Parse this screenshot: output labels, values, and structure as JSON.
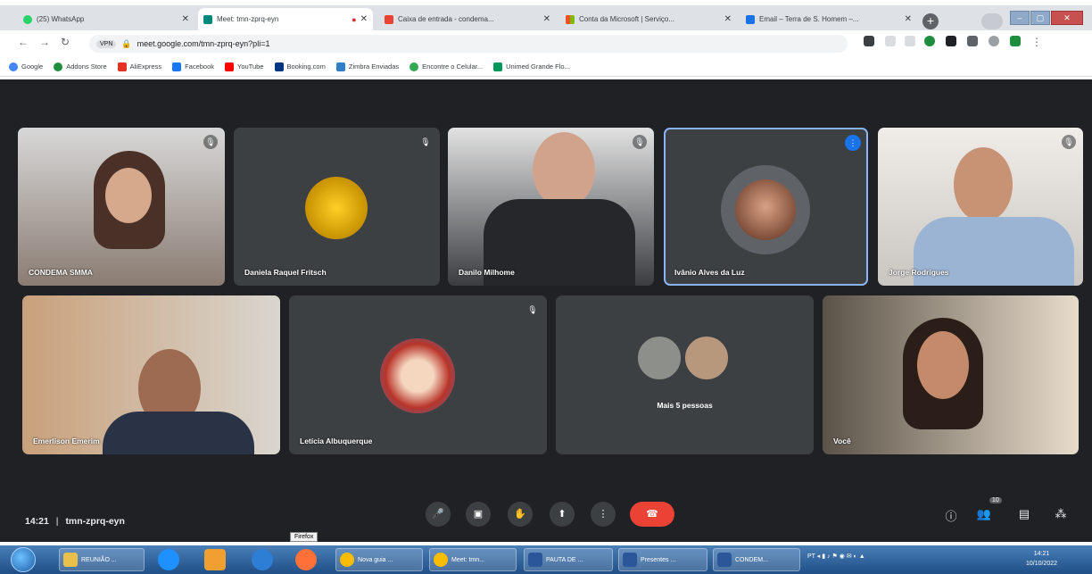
{
  "browser": {
    "tabs": [
      {
        "title": "(25) WhatsApp",
        "active": false
      },
      {
        "title": "Meet: tmn-zprq-eyn",
        "active": true
      },
      {
        "title": "Caixa de entrada - condema...",
        "active": false
      },
      {
        "title": "Conta da Microsoft | Serviço...",
        "active": false
      },
      {
        "title": "Email – Terra de S. Homem –...",
        "active": false
      }
    ],
    "url": "meet.google.com/tmn-zprq-eyn?pli=1",
    "vpn_label": "VPN",
    "bookmarks": [
      "Google",
      "Addons Store",
      "AliExpress",
      "Facebook",
      "YouTube",
      "Booking.com",
      "Zimbra Enviadas",
      "Encontre o Celular...",
      "Unimed Grande Flo..."
    ]
  },
  "meet": {
    "participants": [
      {
        "name": "CONDEMA SMMA",
        "muted": true
      },
      {
        "name": "Daniela Raquel Fritsch",
        "muted": true
      },
      {
        "name": "Danilo Milhome",
        "muted": true
      },
      {
        "name": "Ivânio Alves da Luz",
        "speaking": true
      },
      {
        "name": "Jorge Rodrigues",
        "muted": true
      },
      {
        "name": "Emerlison Emerim"
      },
      {
        "name": "Letícia Albuquerque",
        "muted": true
      },
      {
        "name": "Mais 5 pessoas"
      },
      {
        "name": "Você"
      }
    ],
    "time": "14:21",
    "separator": "|",
    "meeting_code": "tmn-zprq-eyn",
    "people_count": "10",
    "tooltip": "Firefox"
  },
  "taskbar": {
    "items": [
      "REUNIÃO ...",
      "Nova guia ...",
      "Meet: tmn...",
      "PAUTA DE ...",
      "Presentes ...",
      "CONDEM..."
    ],
    "tray_lang": "PT",
    "clock_time": "14:21",
    "clock_date": "10/10/2022"
  }
}
